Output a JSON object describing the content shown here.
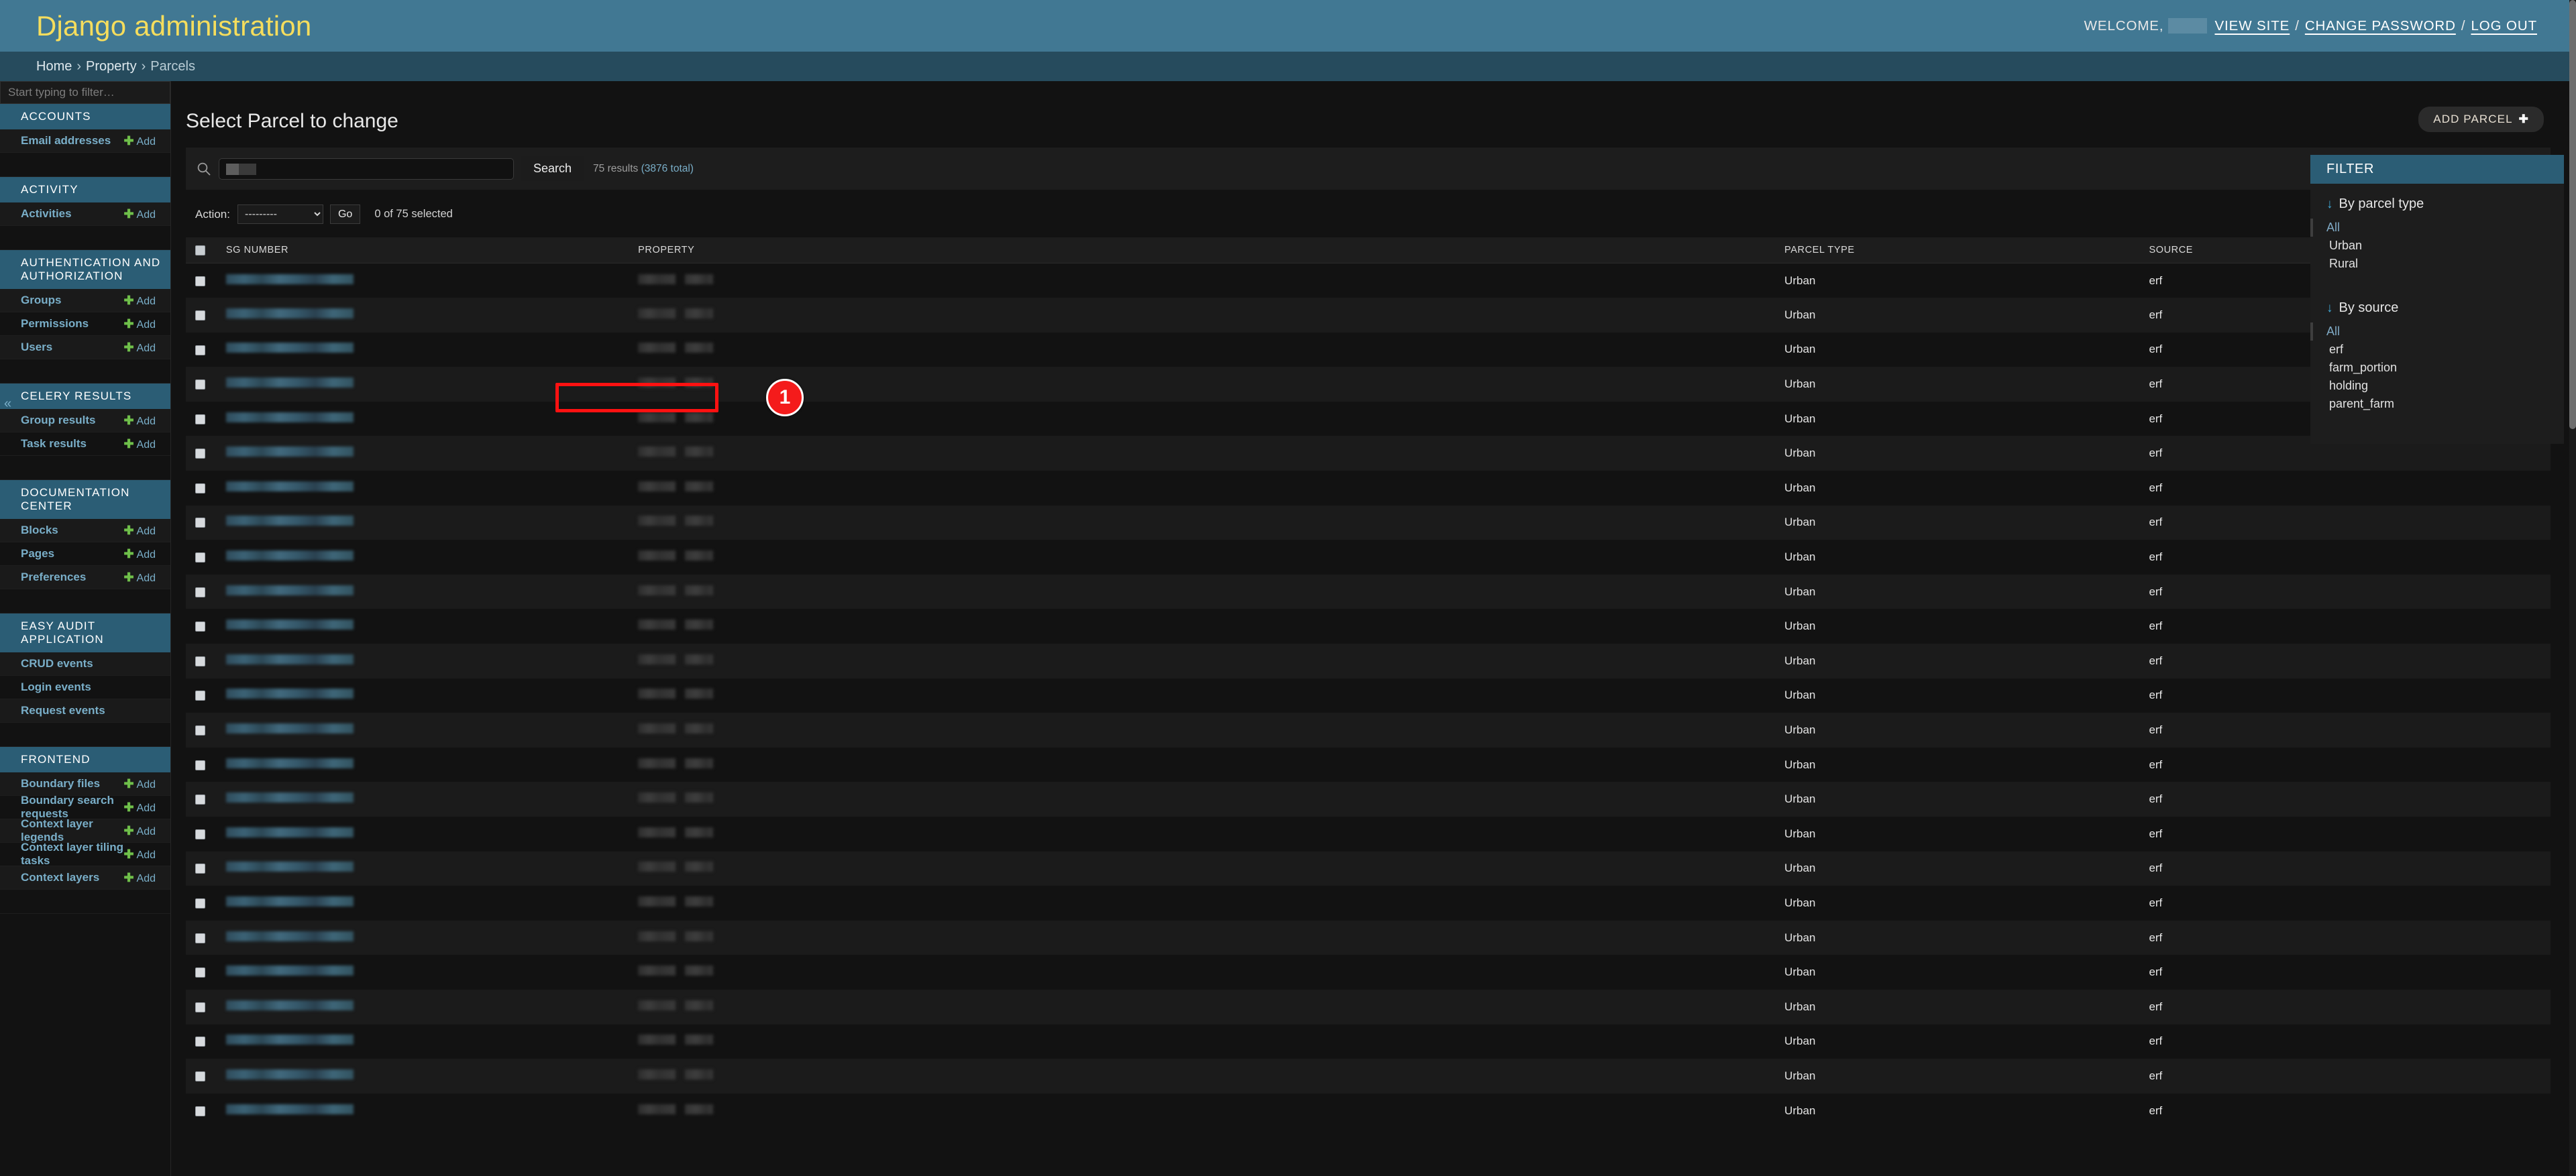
{
  "header": {
    "site_title": "Django administration",
    "welcome_label": "WELCOME,",
    "username_redacted": "",
    "links": [
      {
        "label": "VIEW SITE"
      },
      {
        "label": "CHANGE PASSWORD"
      },
      {
        "label": "LOG OUT"
      }
    ],
    "separator": "/"
  },
  "breadcrumbs": {
    "home": "Home",
    "app": "Property",
    "current": "Parcels",
    "separator": "›"
  },
  "nav_sidebar": {
    "filter_placeholder": "Start typing to filter…",
    "toggle_icon": "«",
    "add_label": "Add",
    "apps": [
      {
        "caption": "ACCOUNTS",
        "models": [
          {
            "label": "Email addresses",
            "add": true
          }
        ]
      },
      {
        "caption": "ACTIVITY",
        "models": [
          {
            "label": "Activities",
            "add": true
          }
        ]
      },
      {
        "caption": "AUTHENTICATION AND AUTHORIZATION",
        "models": [
          {
            "label": "Groups",
            "add": true
          },
          {
            "label": "Permissions",
            "add": true
          },
          {
            "label": "Users",
            "add": true
          }
        ]
      },
      {
        "caption": "CELERY RESULTS",
        "models": [
          {
            "label": "Group results",
            "add": true
          },
          {
            "label": "Task results",
            "add": true
          }
        ]
      },
      {
        "caption": "DOCUMENTATION CENTER",
        "models": [
          {
            "label": "Blocks",
            "add": true
          },
          {
            "label": "Pages",
            "add": true
          },
          {
            "label": "Preferences",
            "add": true
          }
        ]
      },
      {
        "caption": "EASY AUDIT APPLICATION",
        "models": [
          {
            "label": "CRUD events",
            "add": false
          },
          {
            "label": "Login events",
            "add": false
          },
          {
            "label": "Request events",
            "add": false
          }
        ]
      },
      {
        "caption": "FRONTEND",
        "models": [
          {
            "label": "Boundary files",
            "add": true
          },
          {
            "label": "Boundary search requests",
            "add": true
          },
          {
            "label": "Context layer legends",
            "add": true
          },
          {
            "label": "Context layer tiling tasks",
            "add": true
          },
          {
            "label": "Context layers",
            "add": true
          }
        ]
      }
    ]
  },
  "main": {
    "page_title": "Select Parcel to change",
    "add_button": {
      "label": "ADD PARCEL",
      "plus": "✚"
    },
    "search": {
      "value": "",
      "submit_label": "Search",
      "result_count_text": "75 results",
      "total_text": "(3876 total)",
      "icon": "search-icon"
    },
    "actions": {
      "label": "Action:",
      "selected_option": "---------",
      "options": [
        "---------"
      ],
      "go_label": "Go",
      "counter": "0 of 75 selected"
    },
    "table": {
      "columns": [
        "SG NUMBER",
        "PROPERTY",
        "PARCEL TYPE",
        "SOURCE"
      ],
      "rows": [
        {
          "sg_number": "",
          "property": "",
          "parcel_type": "Urban",
          "source": "erf",
          "highlighted": true
        },
        {
          "sg_number": "",
          "property": "",
          "parcel_type": "Urban",
          "source": "erf"
        },
        {
          "sg_number": "",
          "property": "",
          "parcel_type": "Urban",
          "source": "erf"
        },
        {
          "sg_number": "",
          "property": "",
          "parcel_type": "Urban",
          "source": "erf"
        },
        {
          "sg_number": "",
          "property": "",
          "parcel_type": "Urban",
          "source": "erf"
        },
        {
          "sg_number": "",
          "property": "",
          "parcel_type": "Urban",
          "source": "erf"
        },
        {
          "sg_number": "",
          "property": "",
          "parcel_type": "Urban",
          "source": "erf"
        },
        {
          "sg_number": "",
          "property": "",
          "parcel_type": "Urban",
          "source": "erf"
        },
        {
          "sg_number": "",
          "property": "",
          "parcel_type": "Urban",
          "source": "erf"
        },
        {
          "sg_number": "",
          "property": "",
          "parcel_type": "Urban",
          "source": "erf"
        },
        {
          "sg_number": "",
          "property": "",
          "parcel_type": "Urban",
          "source": "erf"
        },
        {
          "sg_number": "",
          "property": "",
          "parcel_type": "Urban",
          "source": "erf"
        },
        {
          "sg_number": "",
          "property": "",
          "parcel_type": "Urban",
          "source": "erf"
        },
        {
          "sg_number": "",
          "property": "",
          "parcel_type": "Urban",
          "source": "erf"
        },
        {
          "sg_number": "",
          "property": "",
          "parcel_type": "Urban",
          "source": "erf"
        },
        {
          "sg_number": "",
          "property": "",
          "parcel_type": "Urban",
          "source": "erf"
        },
        {
          "sg_number": "",
          "property": "",
          "parcel_type": "Urban",
          "source": "erf"
        },
        {
          "sg_number": "",
          "property": "",
          "parcel_type": "Urban",
          "source": "erf"
        },
        {
          "sg_number": "",
          "property": "",
          "parcel_type": "Urban",
          "source": "erf"
        },
        {
          "sg_number": "",
          "property": "",
          "parcel_type": "Urban",
          "source": "erf"
        },
        {
          "sg_number": "",
          "property": "",
          "parcel_type": "Urban",
          "source": "erf"
        },
        {
          "sg_number": "",
          "property": "",
          "parcel_type": "Urban",
          "source": "erf"
        },
        {
          "sg_number": "",
          "property": "",
          "parcel_type": "Urban",
          "source": "erf"
        },
        {
          "sg_number": "",
          "property": "",
          "parcel_type": "Urban",
          "source": "erf"
        },
        {
          "sg_number": "",
          "property": "",
          "parcel_type": "Urban",
          "source": "erf"
        }
      ]
    },
    "annotation": {
      "number": "1"
    }
  },
  "filter_panel": {
    "title": "FILTER",
    "arrow_icon": "↓",
    "groups": [
      {
        "title": "By parcel type",
        "options": [
          {
            "label": "All",
            "selected": true
          },
          {
            "label": "Urban",
            "selected": false
          },
          {
            "label": "Rural",
            "selected": false
          }
        ]
      },
      {
        "title": "By source",
        "options": [
          {
            "label": "All",
            "selected": true
          },
          {
            "label": "erf",
            "selected": false
          },
          {
            "label": "farm_portion",
            "selected": false
          },
          {
            "label": "holding",
            "selected": false
          },
          {
            "label": "parent_farm",
            "selected": false
          }
        ]
      }
    ]
  },
  "colors": {
    "header_bg": "#417893",
    "header_title": "#f5dd5d",
    "breadcrumb_bg": "#264b5d",
    "section_header_bg": "#2b5d75",
    "link_blue": "#79aec8",
    "add_green": "#6fbf4a",
    "page_bg": "#121212",
    "annotation_red": "#f41b1b"
  }
}
